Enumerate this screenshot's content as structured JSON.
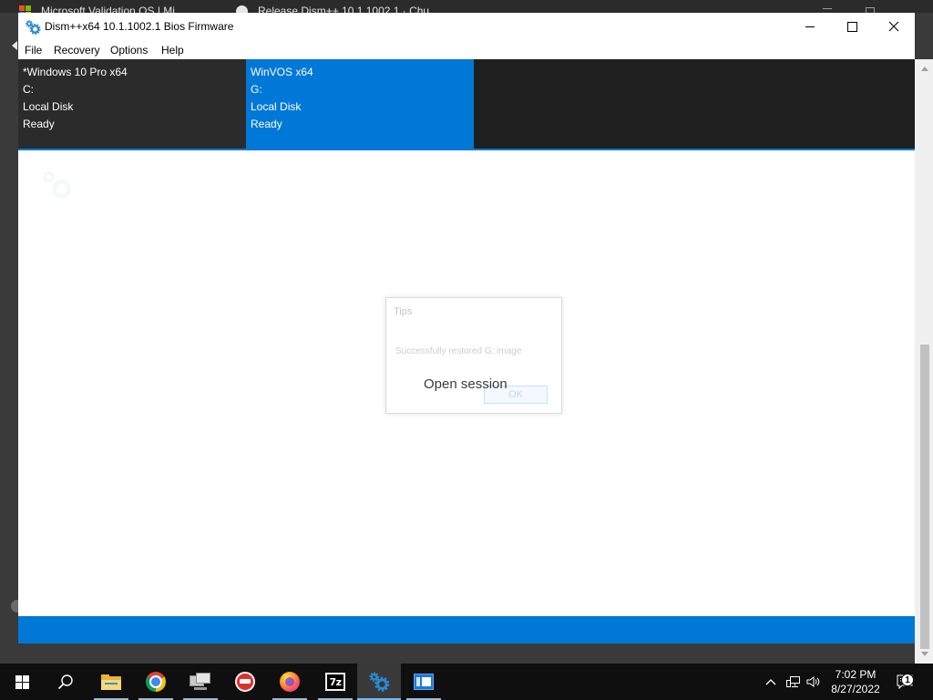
{
  "browser": {
    "tabs": [
      {
        "title": "Microsoft Validation OS | Mi",
        "icon": "microsoft-logo-icon"
      },
      {
        "title": "Release Dism++ 10.1.1002.1 · Chu",
        "icon": "github-icon"
      }
    ]
  },
  "window": {
    "title": "Dism++x64 10.1.1002.1 Bios Firmware",
    "icon": "dism-gear-icon",
    "controls": [
      "minimize-icon",
      "maximize-icon",
      "close-icon"
    ]
  },
  "menu": {
    "items": [
      "File",
      "Recovery",
      "Options",
      "Help"
    ]
  },
  "sessions": [
    {
      "name": "*Windows 10 Pro x64",
      "drive": "C:",
      "disk_type": "Local Disk",
      "status": "Ready",
      "selected": false
    },
    {
      "name": "WinVOS x64",
      "drive": "G:",
      "disk_type": "Local Disk",
      "status": "Ready",
      "selected": true
    }
  ],
  "dialog": {
    "title": "Tips",
    "message": "Successfully restored G: image",
    "ok_label": "OK"
  },
  "overlay": {
    "text": "Open session"
  },
  "taskbar": {
    "start_icon": "windows-start-icon",
    "search_icon": "search-icon",
    "apps": [
      {
        "icon": "file-explorer-icon",
        "running": true,
        "active": false
      },
      {
        "icon": "chrome-icon",
        "running": true,
        "active": false
      },
      {
        "icon": "monitor-app-icon",
        "running": true,
        "active": false
      },
      {
        "icon": "red-app-icon",
        "running": false,
        "active": false
      },
      {
        "icon": "firefox-icon",
        "running": true,
        "active": false
      },
      {
        "icon": "7zip-icon",
        "glyph": "7z",
        "running": true,
        "active": false
      },
      {
        "icon": "dism-gear-icon",
        "running": true,
        "active": true
      },
      {
        "icon": "blue-window-app-icon",
        "running": true,
        "active": false
      }
    ],
    "tray": {
      "icons": [
        "chevron-up-icon",
        "network-icon",
        "volume-icon",
        "notification-icon"
      ],
      "time": "7:02 PM",
      "date": "8/27/2022",
      "notification_count": "1"
    }
  },
  "colors": {
    "accent": "#0078d7",
    "session_panel": "#1f1f1f",
    "session_tile": "#2b2b2b",
    "taskbar": "#0f0f0f"
  }
}
